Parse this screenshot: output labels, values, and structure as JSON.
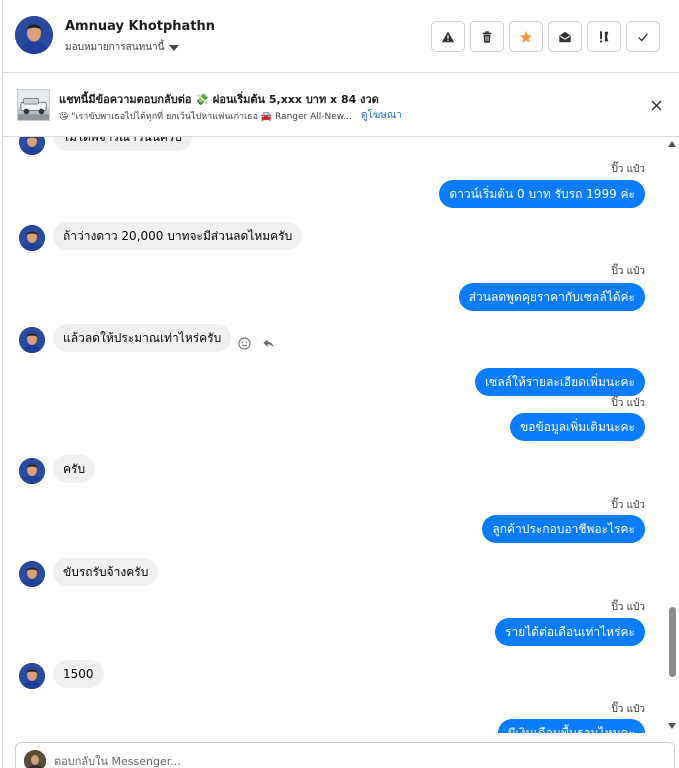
{
  "header": {
    "name": "Amnuay Khotphathn",
    "assign_label": "มอบหมายการสนทนานี้",
    "tools": [
      {
        "icon": "warning-icon"
      },
      {
        "icon": "trash-icon"
      },
      {
        "icon": "star-icon",
        "color": "#f7923a"
      },
      {
        "icon": "envelope-open-icon"
      },
      {
        "icon": "important-icon"
      },
      {
        "icon": "check-icon"
      }
    ]
  },
  "banner": {
    "title": "แชทนี้มีข้อความตอบกลับต่อ 💸 ผ่อนเริ่มต้น 5,xxx บาท x 84 งวด",
    "subtitle": "😘 \"เราขับพาเธอไปได้ทุกที่ ยกเว้นไปหาแฟนเก่าเธอ 🚘 Ranger All-New...",
    "link": "ดูโฆษณา"
  },
  "messages": [
    {
      "dir": "in",
      "text": "ไม่ได้พิจารณาวันนี้ครับ"
    },
    {
      "dir": "out",
      "sender": "ปิ๊ว แป๋ว",
      "text": "ดาวน์เริ่มต้น 0 บาท รับรถ 1999 ค่ะ"
    },
    {
      "dir": "in",
      "text": "ถ้าว่างดาว 20,000 บาทจะมีส่วนลดไหมครับ"
    },
    {
      "dir": "out",
      "sender": "ปิ๊ว แป๋ว",
      "text": "ส่วนลดพูดคุยราคากับเซลล์ได้ค่ะ"
    },
    {
      "dir": "in",
      "text": "แล้วลดให้ประมาณเท่าไหร่ครับ"
    },
    {
      "dir": "out",
      "text": "เซลล์ให้รายละเอียดเพิ่มนะคะ"
    },
    {
      "dir": "out",
      "sender": "ปิ๊ว แป๋ว",
      "text": "ขอข้อมูลเพิ่มเติมนะคะ"
    },
    {
      "dir": "in",
      "text": "ครับ"
    },
    {
      "dir": "out",
      "sender": "ปิ๊ว แป๋ว",
      "text": "ลูกค้าประกอบอาชีพอะไรคะ"
    },
    {
      "dir": "in",
      "text": "ขับรถรับจ้างครับ"
    },
    {
      "dir": "out",
      "sender": "ปิ๊ว แป๋ว",
      "text": "รายได้ต่อเดือนเท่าไหร่คะ"
    },
    {
      "dir": "in",
      "text": "1500"
    },
    {
      "dir": "out",
      "sender": "ปิ๊ว แป๋ว",
      "text": "มีเงินเดือนพื้นฐานไหมคะ"
    }
  ],
  "composer": {
    "placeholder": "ตอบกลับใน Messenger..."
  },
  "colors": {
    "outgoing_bubble": "#0a7cff",
    "incoming_bubble": "#f0f0f0",
    "link": "#216fdb"
  }
}
